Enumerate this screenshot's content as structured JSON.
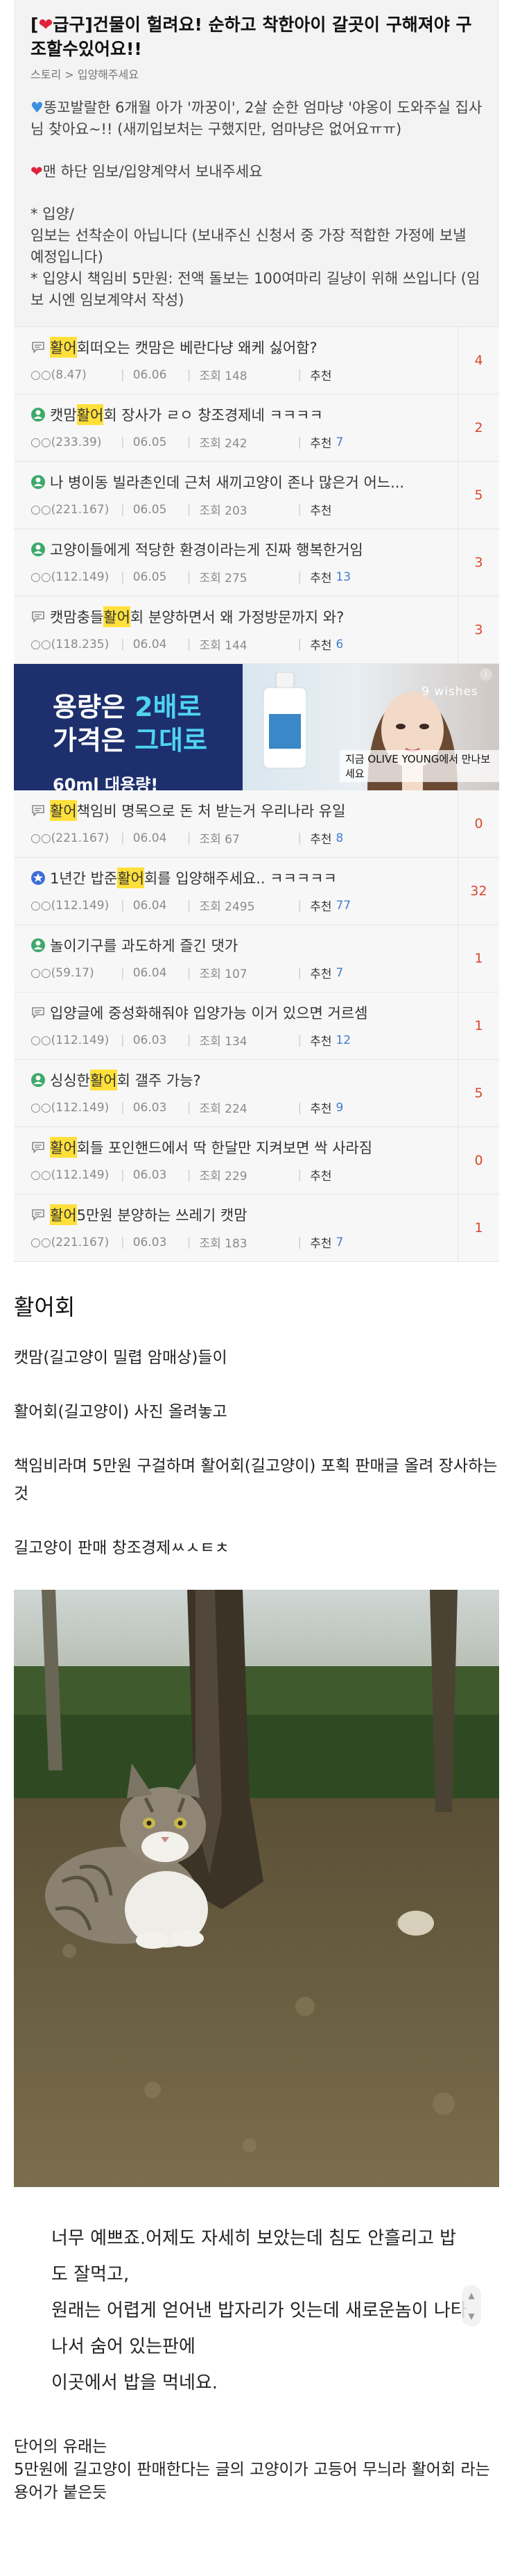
{
  "notice": {
    "title_prefix": "[",
    "title_tag": "급구]건물이 헐려요! 순하고 착한아이 갈곳이 구해져야 구조할수있어요!!",
    "breadcrumb": "스토리 > 입양해주세요",
    "para1": "똥꼬발랄한 6개월 아가 '까꿍이', 2살 순한 엄마냥 '야옹이 도와주실 집사님 찾아요~!! (새끼입보처는 구했지만, 엄마냥은 없어요ㅠㅠ)",
    "para2": "맨 하단 임보/입양계약서 보내주세요",
    "para3_l1": "* 입양/",
    "para3_l2": "임보는 선착순이 아닙니다 (보내주신 신청서 중 가장 적합한 가정에 보낼 예정입니다)",
    "para3_l3": "* 입양시 책임비 5만원: 전액 돌보는 100여마리 길냥이 위해 쓰입니다 (임보 시엔 임보계약서 작성)"
  },
  "labels": {
    "date_sep": "|",
    "views": "조회",
    "recommend": "추천"
  },
  "posts": [
    {
      "pre": "",
      "hl": "활어",
      "post": "회떠오는 캣맘은 베란다냥 왜케 싫어함?",
      "ip": "(8.47)",
      "date": "06.06",
      "views": "148",
      "rec": "",
      "count": "4",
      "icon": "chat"
    },
    {
      "pre": "캣맘 ",
      "hl": "활어",
      "post": "회 장사가 ㄹㅇ 창조경제네 ㅋㅋㅋㅋ",
      "ip": "(233.39)",
      "date": "06.05",
      "views": "242",
      "rec": "7",
      "count": "2",
      "icon": "green"
    },
    {
      "pre": "",
      "hl": "",
      "post": "나 병이동 빌라촌인데 근처 새끼고양이 존나 많은거 어느...",
      "ip": "(221.167)",
      "date": "06.05",
      "views": "203",
      "rec": "",
      "count": "5",
      "icon": "green"
    },
    {
      "pre": "",
      "hl": "",
      "post": "고양이들에게 적당한 환경이라는게 진짜 행복한거임",
      "ip": "(112.149)",
      "date": "06.05",
      "views": "275",
      "rec": "13",
      "count": "3",
      "icon": "green"
    },
    {
      "pre": "캣맘충들 ",
      "hl": "활어",
      "post": "회 분양하면서 왜 가정방문까지 와?",
      "ip": "(118.235)",
      "date": "06.04",
      "views": "144",
      "rec": "6",
      "count": "3",
      "icon": "chat"
    },
    {
      "pre": "",
      "hl": "활어",
      "post": " 책임비 명목으로 돈 처 받는거 우리나라 유일",
      "ip": "(221.167)",
      "date": "06.04",
      "views": "67",
      "rec": "8",
      "count": "0",
      "icon": "chat"
    },
    {
      "pre": "1년간 밥준 ",
      "hl": "활어",
      "post": "회를 입양해주세요.. ㅋㅋㅋㅋㅋ",
      "ip": "(112.149)",
      "date": "06.04",
      "views": "2495",
      "rec": "77",
      "count": "32",
      "icon": "star"
    },
    {
      "pre": "",
      "hl": "",
      "post": "놀이기구를 과도하게 즐긴 댓가",
      "ip": "(59.17)",
      "date": "06.04",
      "views": "107",
      "rec": "7",
      "count": "1",
      "icon": "green"
    },
    {
      "pre": "",
      "hl": "",
      "post": "입양글에 중성화해줘야 입양가능 이거 있으면 거르셈",
      "ip": "(112.149)",
      "date": "06.03",
      "views": "134",
      "rec": "12",
      "count": "1",
      "icon": "chat"
    },
    {
      "pre": "싱싱한 ",
      "hl": "활어",
      "post": "회 갤주 가능?",
      "ip": "(112.149)",
      "date": "06.03",
      "views": "224",
      "rec": "9",
      "count": "5",
      "icon": "green"
    },
    {
      "pre": "",
      "hl": "활어",
      "post": "회들 포인핸드에서 딱 한달만 지켜보면 싹 사라짐",
      "ip": "(112.149)",
      "date": "06.03",
      "views": "229",
      "rec": "",
      "count": "0",
      "icon": "chat"
    },
    {
      "pre": "",
      "hl": "활어",
      "post": " 5만원 분양하는 쓰레기 캣맘",
      "ip": "(221.167)",
      "date": "06.03",
      "views": "183",
      "rec": "7",
      "count": "1",
      "icon": "chat"
    }
  ],
  "ad": {
    "line1a": "용량은 ",
    "line1b": "2배로",
    "line2a": "가격은 ",
    "line2b": "그대로",
    "small": "60ml 대용량!",
    "brand": "9 wishes",
    "caption": "지금 OLIVE YOUNG에서 만나보세요",
    "info": "i"
  },
  "article": {
    "title": "활어회",
    "p1": "캣맘(길고양이 밀렵 암매상)들이",
    "p2": "활어회(길고양이) 사진 올려놓고",
    "p3": "책임비라며 5만원 구걸하며 활어회(길고양이) 포획 판매글 올려 장사하는 것",
    "p4": "길고양이 판매 창조경제ㅆㅅㅌㅊ",
    "caption_l1": "너무 예쁘죠.어제도 자세히 보았는데 침도 안흘리고 밥도 잘먹고,",
    "caption_l2": "원래는 어렵게 얻어낸 밥자리가 잇는데 새로운놈이 나타나서 숨어 있는판에",
    "caption_l3": "이곳에서 밥을 먹네요.",
    "tail_l1": "단어의 유래는",
    "tail_l2": "5만원에 길고양이 판매한다는 글의 고양이가 고등어 무늬라 활어회 라는 용어가 붙은듯"
  },
  "colors": {
    "highlight": "#ffe03a",
    "count": "#d9462b",
    "rec": "#3f7ed2",
    "ad_bg": "#1d2f6d",
    "ad_accent": "#4fd4f2"
  }
}
